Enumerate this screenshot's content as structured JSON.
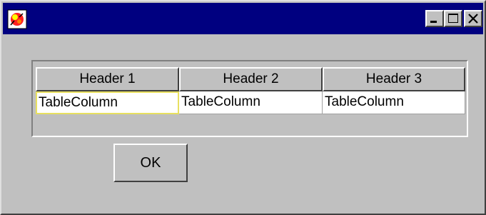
{
  "window": {
    "icon": "java-app-icon",
    "controls": [
      "minimize-icon",
      "maximize-icon",
      "close-icon"
    ],
    "titlebar_color": "#000080"
  },
  "table": {
    "headers": [
      "Header 1",
      "Header 2",
      "Header 3"
    ],
    "rows": [
      [
        "TableColumn",
        "TableColumn",
        "TableColumn"
      ]
    ],
    "selected_cell_color": "#e8e060"
  },
  "ok_label": "OK"
}
